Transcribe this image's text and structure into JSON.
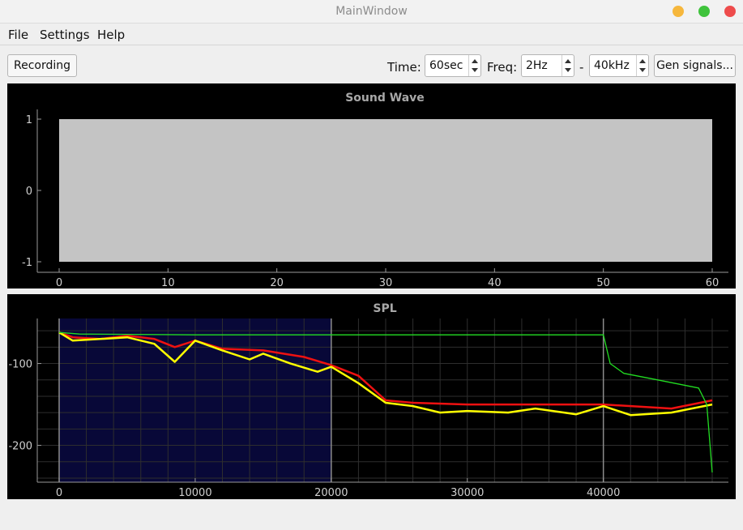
{
  "window": {
    "title": "MainWindow"
  },
  "menu": [
    "File",
    "Settings",
    "Help"
  ],
  "toolbar": {
    "record_label": "Recording",
    "time_label": "Time:",
    "time_value": "60sec",
    "freq_label": "Freq:",
    "freq_min": "2Hz",
    "range_sep": "-",
    "freq_max": "40kHz",
    "gen_label": "Gen signals..."
  },
  "colors": {
    "wave_fill": "#c4c4c4",
    "selection": "#080838",
    "series_red": "#ee1111",
    "series_yellow": "#ffff00",
    "series_green": "#22dd22",
    "grid": "#2e2e2e"
  },
  "chart_data": [
    {
      "type": "area",
      "title": "Sound Wave",
      "xlim": [
        0,
        60
      ],
      "ylim": [
        -1,
        1
      ],
      "x_ticks": [
        "0",
        "10",
        "20",
        "30",
        "40",
        "50",
        "60"
      ],
      "y_ticks": [
        "1",
        "0",
        "-1"
      ],
      "filled_range": {
        "x": [
          0,
          60
        ],
        "y": [
          -1,
          1
        ]
      },
      "grid": false
    },
    {
      "type": "line",
      "title": "SPL",
      "xlim": [
        0,
        48000
      ],
      "ylim": [
        -245,
        -45
      ],
      "x_ticks": [
        "0",
        "10000",
        "20000",
        "30000",
        "40000"
      ],
      "y_ticks": [
        "-100",
        "-200"
      ],
      "grid": true,
      "selection": [
        0,
        20000
      ],
      "markers": [
        0,
        20000,
        40000
      ],
      "series": [
        {
          "color": "#22dd22",
          "x": [
            0,
            1500,
            10000,
            20000,
            30000,
            39000,
            40000,
            40500,
            41500,
            44000,
            47000,
            47600,
            48000
          ],
          "y": [
            -62,
            -64,
            -65,
            -65,
            -65,
            -65,
            -65,
            -100,
            -112,
            -120,
            -130,
            -150,
            -233
          ]
        },
        {
          "color": "#ee1111",
          "x": [
            0,
            1000,
            3000,
            5000,
            7000,
            8500,
            10000,
            12000,
            15000,
            18000,
            20000,
            22000,
            24000,
            26000,
            30000,
            35000,
            40000,
            45000,
            48000
          ],
          "y": [
            -62,
            -68,
            -70,
            -66,
            -70,
            -80,
            -72,
            -82,
            -84,
            -92,
            -102,
            -115,
            -145,
            -148,
            -150,
            -150,
            -150,
            -155,
            -145
          ]
        },
        {
          "color": "#ffff00",
          "x": [
            0,
            1000,
            3000,
            5000,
            7000,
            8500,
            10000,
            12000,
            14000,
            15000,
            17000,
            19000,
            20000,
            22000,
            24000,
            26000,
            28000,
            30000,
            33000,
            35000,
            38000,
            40000,
            42000,
            45000,
            48000
          ],
          "y": [
            -62,
            -72,
            -70,
            -68,
            -76,
            -98,
            -72,
            -84,
            -95,
            -88,
            -100,
            -110,
            -104,
            -124,
            -148,
            -152,
            -160,
            -158,
            -160,
            -155,
            -162,
            -152,
            -163,
            -160,
            -150
          ]
        }
      ]
    }
  ]
}
